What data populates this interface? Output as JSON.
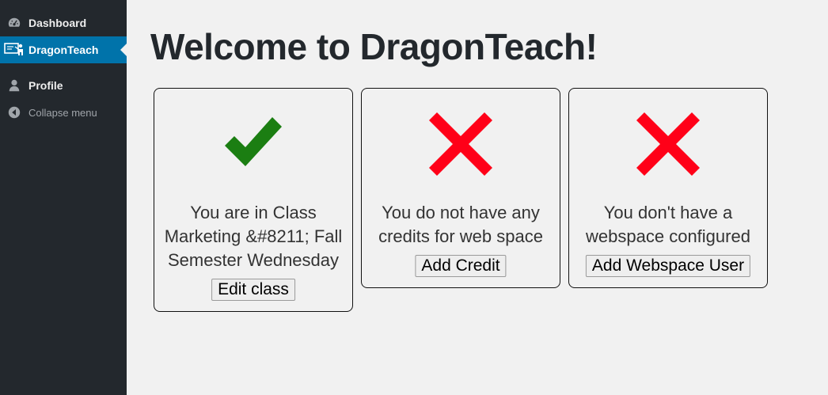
{
  "sidebar": {
    "items": [
      {
        "label": "Dashboard",
        "icon": "dashboard-icon"
      },
      {
        "label": "DragonTeach",
        "icon": "teacher-icon",
        "active": true
      },
      {
        "label": "Profile",
        "icon": "user-icon"
      },
      {
        "label": "Collapse menu",
        "icon": "collapse-icon"
      }
    ]
  },
  "page": {
    "title": "Welcome to DragonTeach!"
  },
  "cards": [
    {
      "status": "check",
      "status_color": "#1b7e12",
      "text": "You are in Class Marketing &#8211; Fall Semester Wednesday",
      "button": "Edit class"
    },
    {
      "status": "cross",
      "status_color": "#ff0018",
      "text": "You do not have any credits for web space",
      "button": "Add Credit"
    },
    {
      "status": "cross",
      "status_color": "#ff0018",
      "text": "You don't have a webspace configured",
      "button": "Add Webspace User"
    }
  ],
  "colors": {
    "sidebar_bg": "#23282d",
    "active_bg": "#0073aa",
    "page_bg": "#f1f1f1"
  }
}
